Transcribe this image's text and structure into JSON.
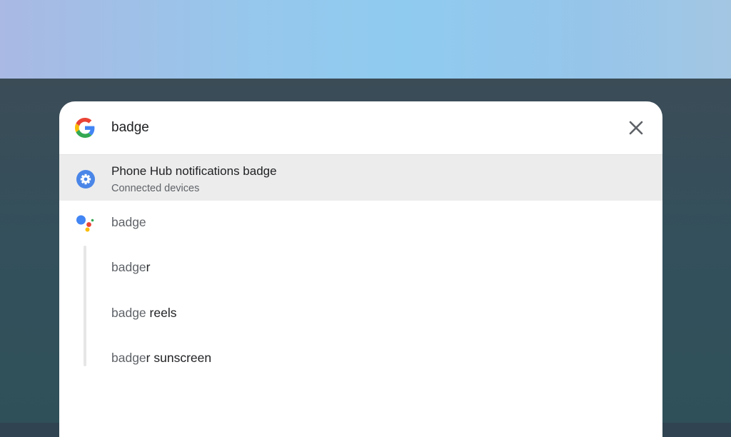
{
  "search": {
    "value": "badge",
    "placeholder": ""
  },
  "icons": {
    "search_provider": "google-g-icon",
    "close": "close-icon",
    "settings": "settings-gear-icon",
    "assistant": "google-assistant-icon"
  },
  "colors": {
    "google_blue": "#4285F4",
    "google_red": "#EA4335",
    "google_yellow": "#FBBC05",
    "google_green": "#34A853",
    "selected_row_bg": "#ECECEC"
  },
  "results": [
    {
      "title": "Phone Hub notifications badge",
      "subtitle": "Connected devices",
      "selected": true
    }
  ],
  "assistant": {
    "query": "badge"
  },
  "suggestions": [
    {
      "query": "badge",
      "rest": "r"
    },
    {
      "query": "badge",
      "rest": " reels"
    },
    {
      "query": "badge",
      "rest": "r sunscreen"
    }
  ]
}
